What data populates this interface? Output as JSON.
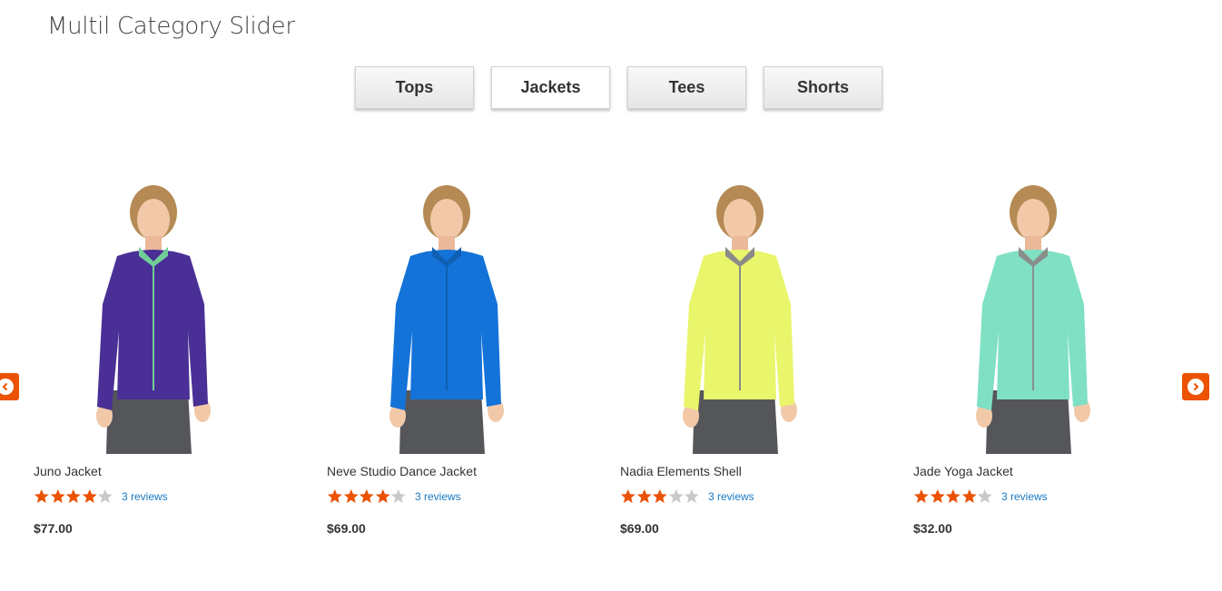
{
  "page_title": "Multil Category Slider",
  "tabs": [
    {
      "label": "Tops",
      "active": false
    },
    {
      "label": "Jackets",
      "active": true
    },
    {
      "label": "Tees",
      "active": false
    },
    {
      "label": "Shorts",
      "active": false
    }
  ],
  "navigation": {
    "prev_icon": "chevron-left-icon",
    "next_icon": "chevron-right-icon",
    "arrow_color": "#eb5202"
  },
  "rating_colors": {
    "filled": "#eb5202",
    "empty": "#c9c9c9"
  },
  "products": [
    {
      "name": "Juno Jacket",
      "rating_fraction": 0.8,
      "reviews": "3 reviews",
      "price": "$77.00",
      "color": "#4a2f96",
      "trim": "#6fcf97"
    },
    {
      "name": "Neve Studio Dance Jacket",
      "rating_fraction": 0.8,
      "reviews": "3 reviews",
      "price": "$69.00",
      "color": "#1473d9",
      "trim": "#0f5fb3"
    },
    {
      "name": "Nadia Elements Shell",
      "rating_fraction": 0.6,
      "reviews": "3 reviews",
      "price": "$69.00",
      "color": "#e9f56a",
      "trim": "#8a8a8a"
    },
    {
      "name": "Jade Yoga Jacket",
      "rating_fraction": 0.8,
      "reviews": "3 reviews",
      "price": "$32.00",
      "color": "#7fe0c4",
      "trim": "#8a8f8c"
    }
  ]
}
